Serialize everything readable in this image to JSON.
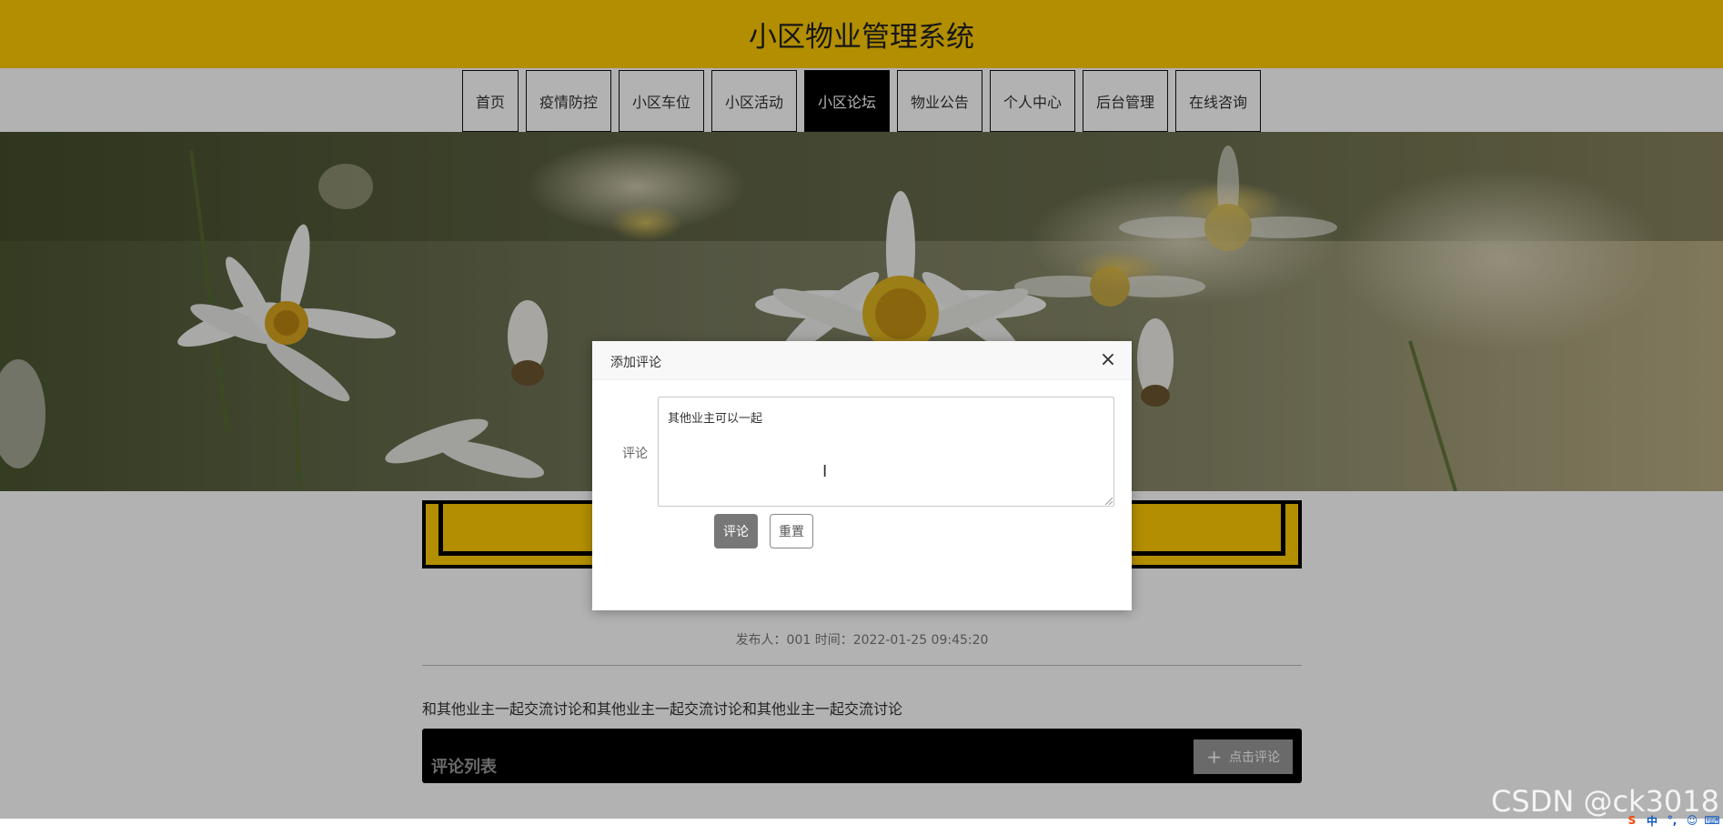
{
  "header": {
    "title": "小区物业管理系统"
  },
  "nav": {
    "items": [
      {
        "label": "首页"
      },
      {
        "label": "疫情防控"
      },
      {
        "label": "小区车位"
      },
      {
        "label": "小区活动"
      },
      {
        "label": "小区论坛",
        "active": true
      },
      {
        "label": "物业公告"
      },
      {
        "label": "个人中心"
      },
      {
        "label": "后台管理"
      },
      {
        "label": "在线咨询"
      }
    ]
  },
  "post": {
    "meta": "发布人：001 时间：2022-01-25 09:45:20",
    "body": "和其他业主一起交流讨论和其他业主一起交流讨论和其他业主一起交流讨论"
  },
  "comments": {
    "title": "评论列表",
    "add_button_label": "点击评论"
  },
  "modal": {
    "title": "添加评论",
    "field_label": "评论",
    "textarea_value": "其他业主可以一起",
    "submit_label": "评论",
    "reset_label": "重置"
  },
  "watermark": "CSDN @ck3018",
  "colors": {
    "accent": "#ffcc00",
    "nav_active_bg": "#000000"
  },
  "icons": {
    "close": "close-icon",
    "plus": "plus-icon",
    "tray": [
      "sogou-icon",
      "ime-zh-icon",
      "punctuation-icon",
      "emoji-icon",
      "keyboard-icon"
    ]
  }
}
